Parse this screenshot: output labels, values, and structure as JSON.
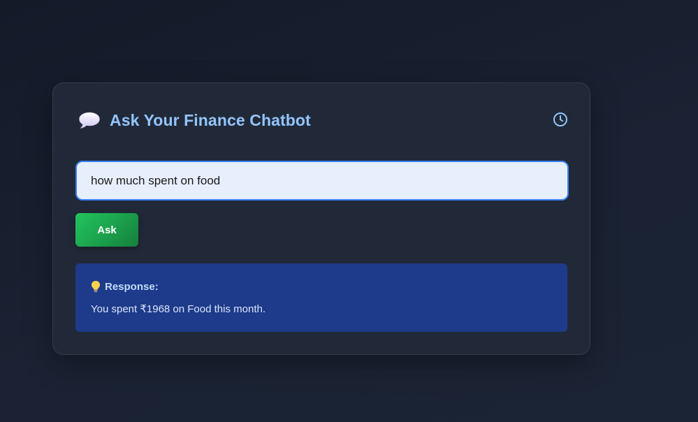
{
  "header": {
    "title": "Ask Your Finance Chatbot",
    "title_icon": "speech-bubble-icon",
    "history_icon": "clock-icon"
  },
  "query": {
    "value": "how much spent on food",
    "placeholder": ""
  },
  "ask_button": {
    "label": "Ask"
  },
  "response": {
    "icon": "lightbulb-icon",
    "label": "Response:",
    "text": "You spent ₹1968 on Food this month."
  },
  "colors": {
    "background": "#161d2b",
    "card": "#212938",
    "title": "#93c5fd",
    "input_bg": "#e8effc",
    "input_border": "#3b82f6",
    "button_green": "#22c55e",
    "response_bg": "#1e3a8a"
  }
}
